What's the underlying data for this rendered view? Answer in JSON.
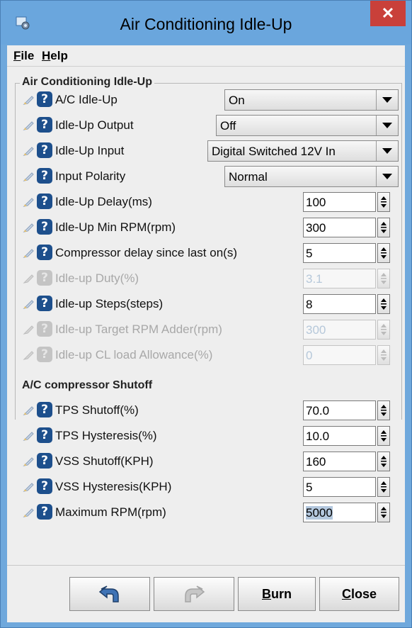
{
  "window": {
    "title": "Air Conditioning Idle-Up",
    "close_glyph": "✕",
    "icon": "app-gear-icon"
  },
  "menu": [
    {
      "label": "File",
      "mnemonic": "F",
      "rest": "ile"
    },
    {
      "label": "Help",
      "mnemonic": "H",
      "rest": "elp"
    }
  ],
  "section1": {
    "title": "Air Conditioning Idle-Up"
  },
  "section2": {
    "title": "A/C compressor Shutoff"
  },
  "help_glyph": "?",
  "fields": {
    "ac_idle_up": {
      "label": "A/C Idle-Up",
      "value": "On"
    },
    "idle_up_output": {
      "label": "Idle-Up Output",
      "value": "Off"
    },
    "idle_up_input": {
      "label": "Idle-Up Input",
      "value": "Digital Switched 12V In"
    },
    "input_polarity": {
      "label": "Input Polarity",
      "value": "Normal"
    },
    "idle_up_delay": {
      "label": "Idle-Up Delay(ms)",
      "value": "100"
    },
    "idle_up_min_rpm": {
      "label": "Idle-Up Min RPM(rpm)",
      "value": "300"
    },
    "compressor_delay": {
      "label": "Compressor delay since last on(s)",
      "value": "5"
    },
    "idle_up_duty": {
      "label": "Idle-up Duty(%)",
      "value": "3.1"
    },
    "idle_up_steps": {
      "label": "Idle-up Steps(steps)",
      "value": "8"
    },
    "target_rpm_adder": {
      "label": "Idle-up Target RPM Adder(rpm)",
      "value": "300"
    },
    "cl_load_allowance": {
      "label": "Idle-up CL load Allowance(%)",
      "value": "0"
    },
    "tps_shutoff": {
      "label": "TPS Shutoff(%)",
      "value": "70.0"
    },
    "tps_hysteresis": {
      "label": "TPS Hysteresis(%)",
      "value": "10.0"
    },
    "vss_shutoff": {
      "label": "VSS Shutoff(KPH)",
      "value": "160"
    },
    "vss_hysteresis": {
      "label": "VSS Hysteresis(KPH)",
      "value": "5"
    },
    "max_rpm": {
      "label": "Maximum RPM(rpm)",
      "value": "5000"
    }
  },
  "buttons": {
    "undo": {
      "icon": "undo-arrow-icon"
    },
    "redo": {
      "icon": "redo-arrow-icon"
    },
    "burn": {
      "label": "Burn",
      "mnemonic": "B",
      "rest": "urn"
    },
    "close": {
      "label": "Close",
      "mnemonic": "C",
      "rest": "lose"
    }
  },
  "colors": {
    "titlebar": "#6aa6dd",
    "close": "#c9403a",
    "help_icon": "#1d4f8c",
    "disabled_text": "#a8a8a8"
  }
}
